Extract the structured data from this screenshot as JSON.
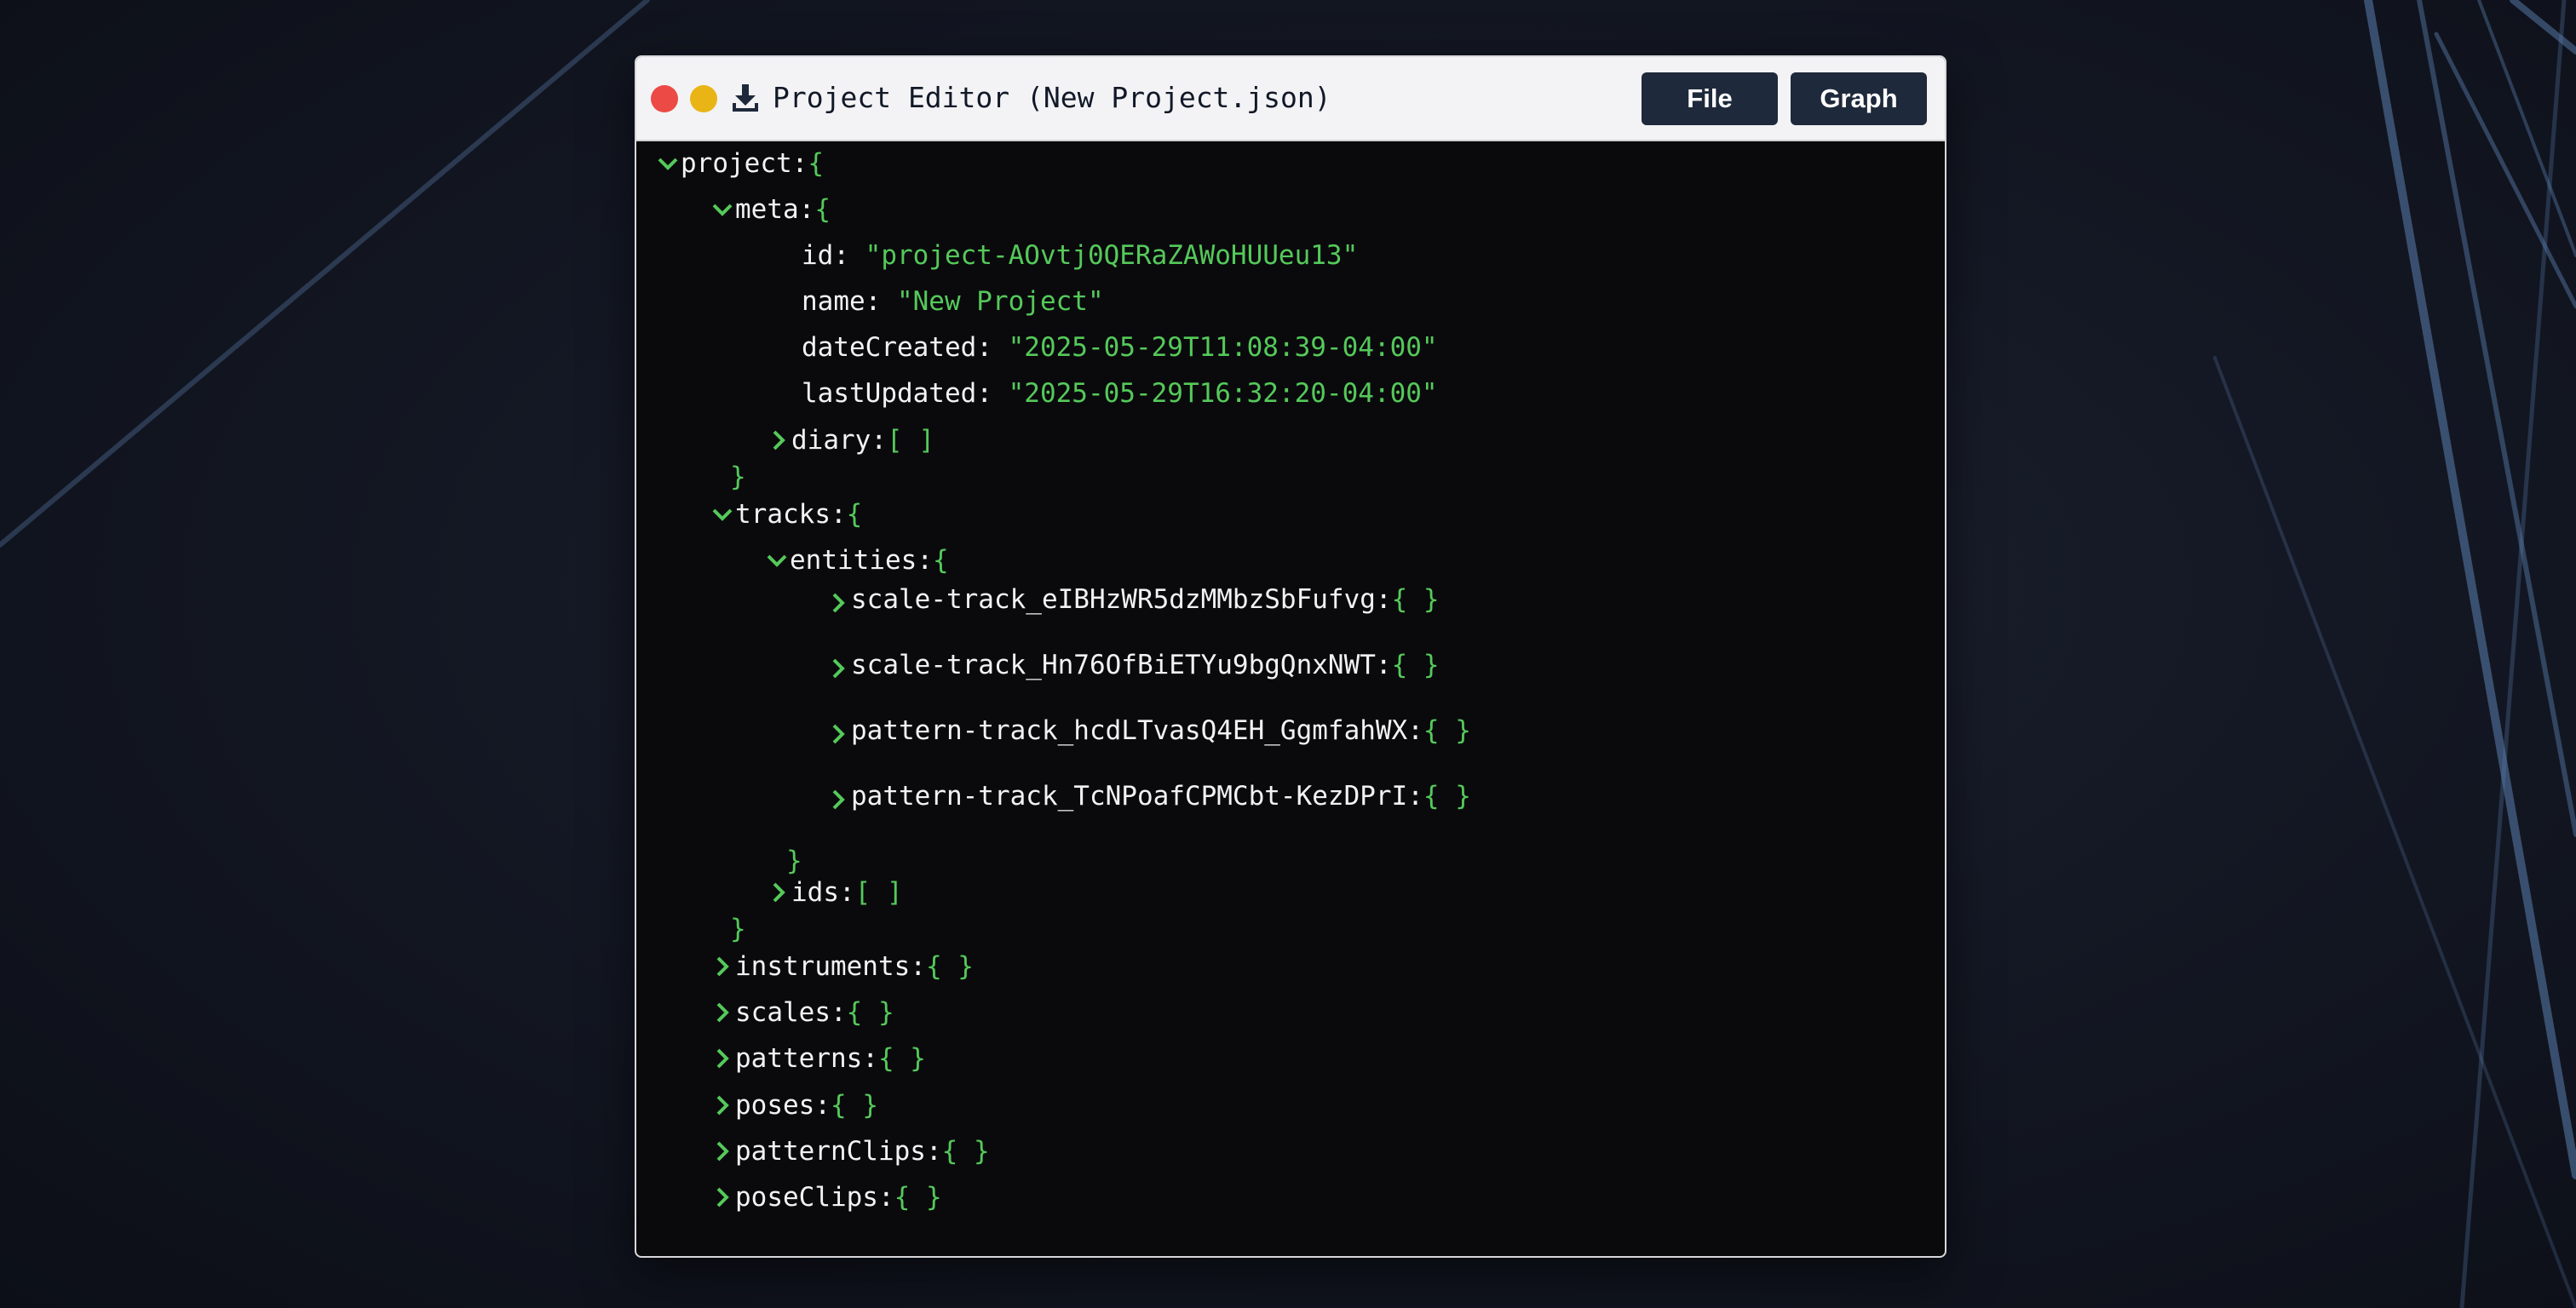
{
  "window": {
    "title": "Project Editor (New Project.json)",
    "file_label": "File",
    "graph_label": "Graph"
  },
  "colors": {
    "key": "#f2f2f2",
    "value": "#55c95a",
    "button_bg": "#1e293b",
    "close": "#ec4a45",
    "minimize": "#e9b416"
  },
  "tree": {
    "project": {
      "key": "project",
      "open": "{"
    },
    "meta": {
      "key": "meta",
      "open": "{",
      "close": "}"
    },
    "id": {
      "key": "id",
      "value": "\"project-AOvtj0QERaZAWoHUUeu13\""
    },
    "name": {
      "key": "name",
      "value": "\"New Project\""
    },
    "dateCreated": {
      "key": "dateCreated",
      "value": "\"2025-05-29T11:08:39-04:00\""
    },
    "lastUpdated": {
      "key": "lastUpdated",
      "value": "\"2025-05-29T16:32:20-04:00\""
    },
    "diary": {
      "key": "diary",
      "value": "[ ]"
    },
    "tracks": {
      "key": "tracks",
      "open": "{",
      "close": "}"
    },
    "entities": {
      "key": "entities",
      "open": "{",
      "close": "}"
    },
    "entity_items": [
      {
        "key": "scale-track_eIBHzWR5dzMMbzSbFufvg",
        "value": "{ }"
      },
      {
        "key": "scale-track_Hn76OfBiETYu9bgQnxNWT",
        "value": "{ }"
      },
      {
        "key": "pattern-track_hcdLTvasQ4EH_GgmfahWX",
        "value": "{ }"
      },
      {
        "key": "pattern-track_TcNPoafCPMCbt-KezDPrI",
        "value": "{ }"
      }
    ],
    "ids": {
      "key": "ids",
      "value": "[ ]"
    },
    "collapsed": [
      {
        "key": "instruments",
        "value": "{ }"
      },
      {
        "key": "scales",
        "value": "{ }"
      },
      {
        "key": "patterns",
        "value": "{ }"
      },
      {
        "key": "poses",
        "value": "{ }"
      },
      {
        "key": "patternClips",
        "value": "{ }"
      },
      {
        "key": "poseClips",
        "value": "{ }"
      }
    ]
  }
}
